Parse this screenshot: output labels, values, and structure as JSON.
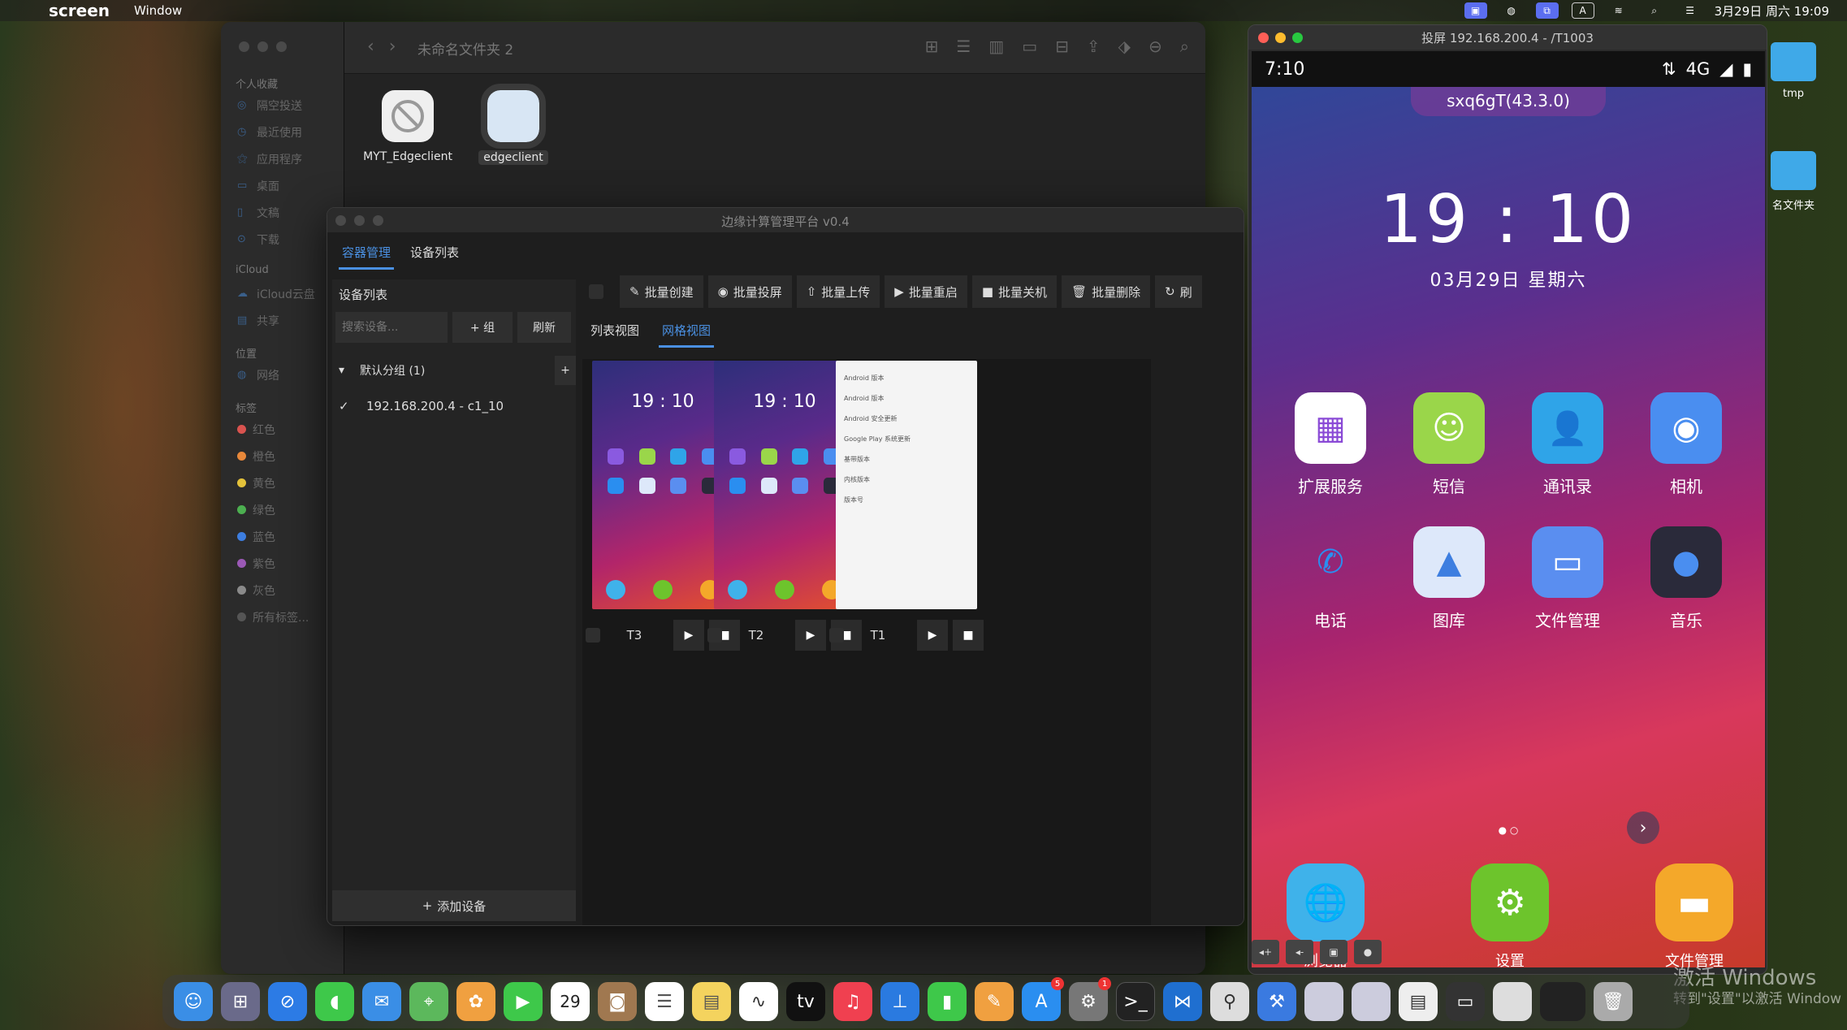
{
  "menubar": {
    "app_name": "screen",
    "menus": [
      "Window"
    ],
    "datetime": "3月29日 周六 19:09"
  },
  "finder": {
    "folder_title": "未命名文件夹 2",
    "sidebar": {
      "favorites_header": "个人收藏",
      "favorites": [
        "隔空投送",
        "最近使用",
        "应用程序",
        "桌面",
        "文稿",
        "下载"
      ],
      "icloud_header": "iCloud",
      "icloud": [
        "iCloud云盘",
        "共享"
      ],
      "locations_header": "位置",
      "locations": [
        "网络"
      ],
      "tags_header": "标签",
      "tags": [
        {
          "label": "红色",
          "color": "#d9534f"
        },
        {
          "label": "橙色",
          "color": "#e8883a"
        },
        {
          "label": "黄色",
          "color": "#e4c23a"
        },
        {
          "label": "绿色",
          "color": "#4caf50"
        },
        {
          "label": "蓝色",
          "color": "#3d7ee0"
        },
        {
          "label": "紫色",
          "color": "#9b59b6"
        },
        {
          "label": "灰色",
          "color": "#8a8a8a"
        },
        {
          "label": "所有标签...",
          "color": "#555555"
        }
      ]
    },
    "files": [
      {
        "name": "MYT_Edgeclient"
      },
      {
        "name": "edgeclient"
      }
    ]
  },
  "edge_app": {
    "title": "边缘计算管理平台 v0.4",
    "tabs": [
      "容器管理",
      "设备列表"
    ],
    "left": {
      "header": "设备列表",
      "search_placeholder": "搜索设备...",
      "add_group_label": "+ 组",
      "refresh_label": "刷新",
      "group_label": "默认分组 (1)",
      "group_add": "+",
      "device": "192.168.200.4 - c1_10",
      "add_device_label": "添加设备"
    },
    "batch_buttons": [
      {
        "icon": "pencil-icon",
        "glyph": "✎",
        "label": "批量创建"
      },
      {
        "icon": "eye-icon",
        "glyph": "◉",
        "label": "批量投屏"
      },
      {
        "icon": "upload-icon",
        "glyph": "⇧",
        "label": "批量上传"
      },
      {
        "icon": "play-icon",
        "glyph": "▶",
        "label": "批量重启"
      },
      {
        "icon": "stop-icon",
        "glyph": "■",
        "label": "批量关机"
      },
      {
        "icon": "trash-icon",
        "glyph": "🗑",
        "label": "批量删除"
      },
      {
        "icon": "refresh-icon",
        "glyph": "↻",
        "label": "刷"
      }
    ],
    "view_tabs": [
      "列表视图",
      "网格视图"
    ],
    "containers": [
      {
        "name": "T3",
        "screen": "home",
        "clock": "19 : 10"
      },
      {
        "name": "T2",
        "screen": "home",
        "clock": "19 : 10"
      },
      {
        "name": "T1",
        "screen": "settings",
        "clock": ""
      }
    ],
    "settings_preview": {
      "title": "Android 版本",
      "rows": [
        "Android 版本",
        "Android 安全更新",
        "Google Play 系统更新",
        "基带版本",
        "内核版本",
        "版本号"
      ]
    }
  },
  "mirror": {
    "title": "投屏 192.168.200.4 - /T1003",
    "status_time": "7:10",
    "status_network": "4G",
    "pill": "sxq6gT(43.3.0)",
    "clock": "19 : 10",
    "date": "03月29日  星期六",
    "apps": [
      {
        "label": "扩展服务",
        "icon": "extension-icon",
        "glyph": "▦",
        "bg": "#ffffff",
        "fg": "#8a4ad6"
      },
      {
        "label": "短信",
        "icon": "sms-icon",
        "glyph": "☺",
        "bg": "#9ad64a",
        "fg": "#ffffff"
      },
      {
        "label": "通讯录",
        "icon": "contacts-icon",
        "glyph": "👤",
        "bg": "#2fa4e8",
        "fg": "#ffffff"
      },
      {
        "label": "相机",
        "icon": "camera-icon",
        "glyph": "◉",
        "bg": "#4a8ef0",
        "fg": "#ffffff"
      },
      {
        "label": "电话",
        "icon": "phone-icon",
        "glyph": "✆",
        "bg": "transparent",
        "fg": "#2a8ef0"
      },
      {
        "label": "图库",
        "icon": "gallery-icon",
        "glyph": "▲",
        "bg": "#dde8fa",
        "fg": "#3d7ee0"
      },
      {
        "label": "文件管理",
        "icon": "file-manager-icon",
        "glyph": "▭",
        "bg": "#5a8ef0",
        "fg": "#ffffff"
      },
      {
        "label": "音乐",
        "icon": "music-icon",
        "glyph": "●",
        "bg": "#2a2a3a",
        "fg": "#4a8ef0"
      }
    ],
    "dock": [
      {
        "label": "浏览器",
        "icon": "browser-icon",
        "glyph": "🌐",
        "bg": "#3fb2ea"
      },
      {
        "label": "设置",
        "icon": "settings-icon",
        "glyph": "⚙",
        "bg": "#6dc42c"
      },
      {
        "label": "文件管理",
        "icon": "files-icon",
        "glyph": "▬",
        "bg": "#f4a82a"
      }
    ]
  },
  "desktop": {
    "icons": [
      "tmp",
      "名文件夹"
    ]
  },
  "watermark": {
    "line1": "激活 Windows",
    "line2": "转到\"设置\"以激活 Window"
  },
  "dock": {
    "calendar_date": "29",
    "badges": {
      "appstore": "5",
      "settings": "1"
    }
  }
}
